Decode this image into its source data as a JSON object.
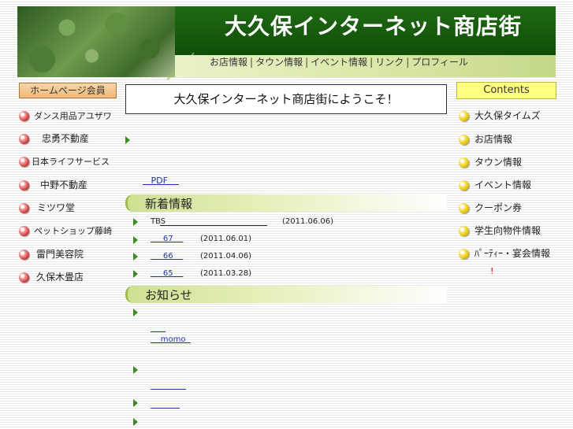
{
  "header": {
    "site_title": "大久保インターネット商店街",
    "nav": [
      "お店情報",
      "タウン情報",
      "イベント情報",
      "リンク",
      "プロフィール"
    ],
    "nav_separator": "|"
  },
  "left_sidebar": {
    "title": "ホームページ会員",
    "items": [
      "ダンス用品アユザワ",
      "忠勇不動産",
      "日本ライフサービス",
      "中野不動産",
      "ミツワ堂",
      "ペットショップ藤崎",
      "雷門美容院",
      "久保木畳店"
    ]
  },
  "main": {
    "welcome": "大久保インターネット商店街にようこそ！",
    "pdf_link": "PDF",
    "news_title": "新着情報",
    "news_items": [
      {
        "label": "TBS",
        "date": "(2011.06.06)"
      },
      {
        "label": "67",
        "date": "(2011.06.01)"
      },
      {
        "label": "66",
        "date": "(2011.04.06)"
      },
      {
        "label": "65",
        "date": "(2011.03.28)"
      }
    ],
    "notice_title": "お知らせ",
    "notice_link": "momo"
  },
  "right_sidebar": {
    "title": "Contents",
    "items": [
      "大久保タイムズ",
      "お店情報",
      "タウン情報",
      "イベント情報",
      "クーポン券",
      "学生向物件情報",
      "ﾊﾟｰﾃｨｰ・宴会情報"
    ],
    "marker": "!"
  },
  "colors": {
    "header_green": "#1f6a12",
    "nav_bar": "#d7e6a3",
    "accent_link": "#2233aa",
    "left_header_bg": "#f0b878",
    "right_header_bg": "#ffff80"
  },
  "icons": {
    "left_bullet": "pink-ball-icon",
    "right_bullet": "yellow-ball-icon",
    "list_marker": "green-triangle-icon"
  }
}
